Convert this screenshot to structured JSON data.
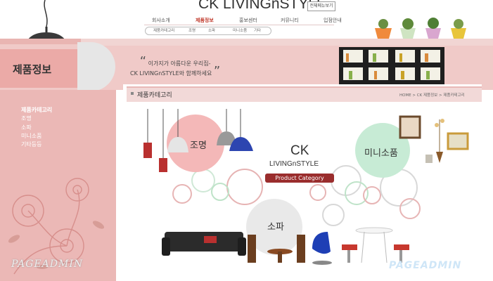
{
  "header": {
    "logo": "CK LIVINGnSTYLE",
    "sitemap_button": "전체메뉴보기",
    "nav": [
      "회사소개",
      "제품정보",
      "홍보센터",
      "커뮤니티",
      "입점안내"
    ],
    "active_nav_index": 1,
    "subnav": [
      "제품카테고리",
      "조명",
      "소파",
      "미니소품",
      "기타"
    ]
  },
  "hero": {
    "title": "제품정보",
    "quote_line1": "이가지가 아름다운 우리집-",
    "quote_line2": "CK LIVINGnSTYLE와 함께하세요"
  },
  "sidebar": {
    "items": [
      "제품카테고리",
      "조명",
      "소파",
      "미니소품",
      "기타등등"
    ],
    "active_index": 0
  },
  "content": {
    "title": "제품카테고리",
    "breadcrumb": "HOME > CK 제품정보 > 제품카테고리",
    "categories": {
      "lighting": "조명",
      "mini": "미니소품",
      "sofa": "소파"
    },
    "brand": {
      "ck": "CK",
      "living": "LIVINGnSTYLE",
      "product_category": "Product Category"
    }
  },
  "watermarks": {
    "left": "PAGEADMIN",
    "right": "PAGEADMIN"
  },
  "colors": {
    "pink": "#f0cac8",
    "accent": "#c0392b",
    "brand_tag": "#9a2d2d",
    "mint": "#c7ebd5"
  }
}
